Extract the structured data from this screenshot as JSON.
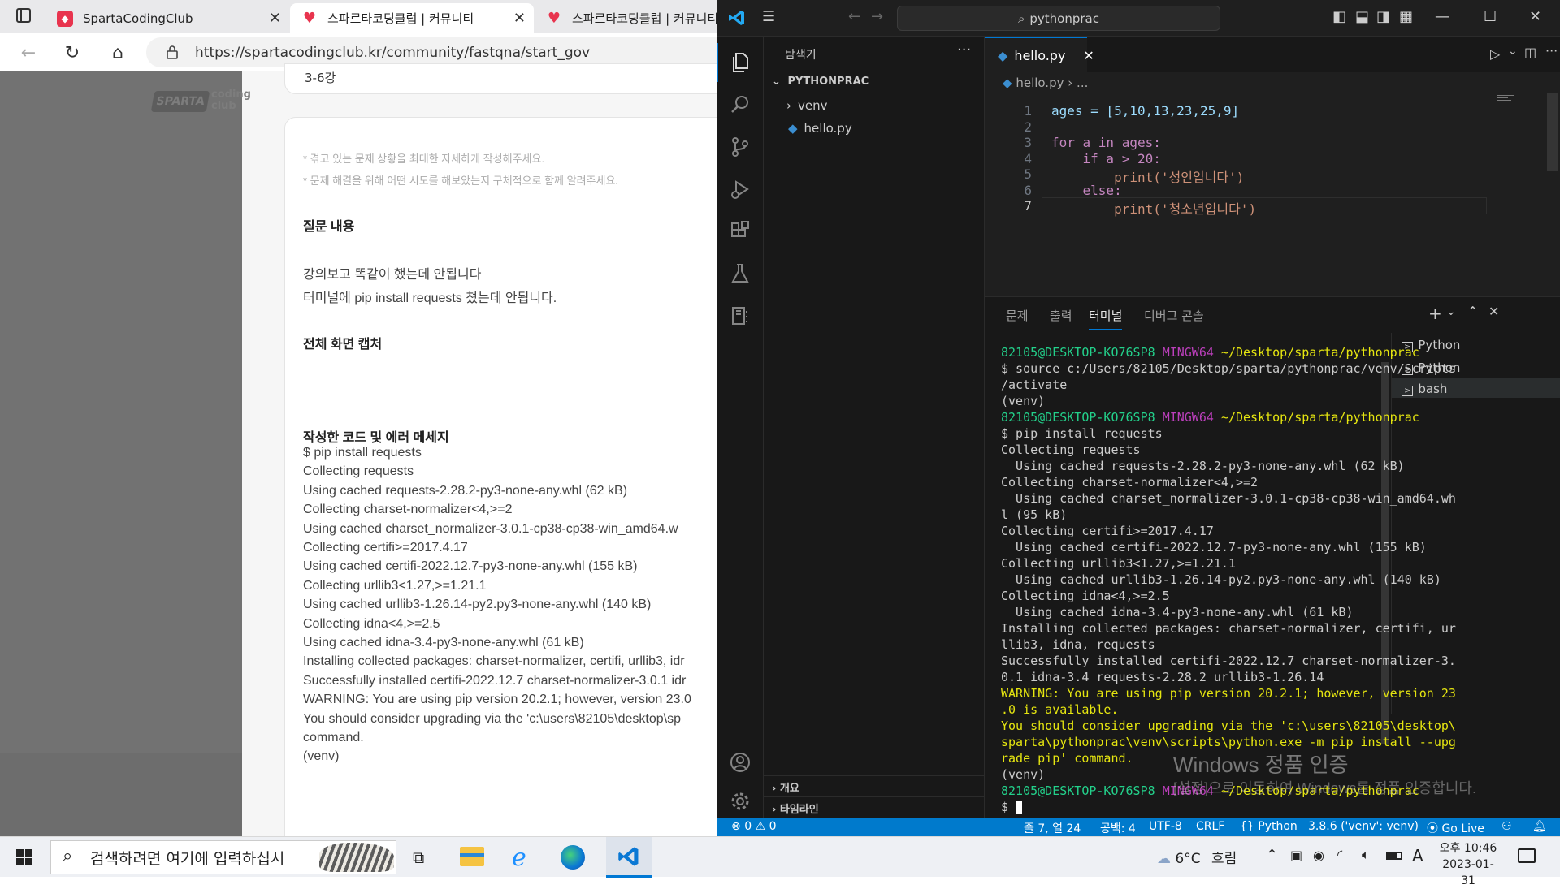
{
  "browser": {
    "tabs": [
      {
        "title": "SpartaCodingClub",
        "active": false
      },
      {
        "title": "스파르타코딩클럽 | 커뮤니티",
        "active": true
      },
      {
        "title": "스파르타코딩클럽 | 커뮤니티",
        "active": false
      }
    ],
    "url": "https://spartacodingclub.kr/community/fastqna/start_gov",
    "logo_text": "SPARTA",
    "logo_sub": "coding club",
    "prev_card_text": "3-6강",
    "notes": [
      "* 겪고 있는 문제 상황을 최대한 자세하게 작성해주세요.",
      "* 문제 해결을 위해 어떤 시도를 해보았는지 구체적으로 함께 알려주세요."
    ],
    "section_question": "질문 내용",
    "question_lines": [
      "강의보고 똑같이 했는데 안됩니다",
      "터미널에 pip install requests 쳤는데 안됩니다."
    ],
    "section_capture": "전체 화면 캡처",
    "section_code": "작성한 코드 및 에러 메세지",
    "code_lines": [
      "$ pip install requests",
      "Collecting requests",
      " Using cached requests-2.28.2-py3-none-any.whl (62 kB)",
      "Collecting charset-normalizer<4,>=2",
      " Using cached charset_normalizer-3.0.1-cp38-cp38-win_amd64.w",
      "Collecting certifi>=2017.4.17",
      " Using cached certifi-2022.12.7-py3-none-any.whl (155 kB)",
      "Collecting urllib3<1.27,>=1.21.1",
      " Using cached urllib3-1.26.14-py2.py3-none-any.whl (140 kB)",
      "Collecting idna<4,>=2.5",
      " Using cached idna-3.4-py3-none-any.whl (61 kB)",
      "Installing collected packages: charset-normalizer, certifi, urllib3, idr",
      "Successfully installed certifi-2022.12.7 charset-normalizer-3.0.1 idr",
      "WARNING: You are using pip version 20.2.1; however, version 23.0",
      "You should consider upgrading via the 'c:\\users\\82105\\desktop\\sp",
      "command.",
      "(venv)"
    ]
  },
  "vscode": {
    "search": "pythonprac",
    "explorer_title": "탐색기",
    "folder": "PYTHONPRAC",
    "tree": [
      "venv",
      "hello.py"
    ],
    "outline": "개요",
    "timeline": "타임라인",
    "tab": "hello.py",
    "breadcrumb_file": "hello.py",
    "breadcrumb_rest": "...",
    "code": [
      "ages = [5,10,13,23,25,9]",
      "",
      "for a in ages:",
      "    if a > 20:",
      "        print('성인입니다')",
      "    else:",
      "        print('청소년입니다')"
    ],
    "panel_tabs": [
      "문제",
      "출력",
      "터미널",
      "디버그 콘솔"
    ],
    "terminal_list": [
      "Python",
      "Python",
      "bash"
    ],
    "terminal": [
      "82105@DESKTOP-KO76SP8 MINGW64 ~/Desktop/sparta/pythonprac",
      "$ source c:/Users/82105/Desktop/sparta/pythonprac/venv/Scripts",
      "/activate",
      "(venv)",
      "82105@DESKTOP-KO76SP8 MINGW64 ~/Desktop/sparta/pythonprac",
      "$ pip install requests",
      "Collecting requests",
      "  Using cached requests-2.28.2-py3-none-any.whl (62 kB)",
      "Collecting charset-normalizer<4,>=2",
      "  Using cached charset_normalizer-3.0.1-cp38-cp38-win_amd64.wh",
      "l (95 kB)",
      "Collecting certifi>=2017.4.17",
      "  Using cached certifi-2022.12.7-py3-none-any.whl (155 kB)",
      "Collecting urllib3<1.27,>=1.21.1",
      "  Using cached urllib3-1.26.14-py2.py3-none-any.whl (140 kB)",
      "Collecting idna<4,>=2.5",
      "  Using cached idna-3.4-py3-none-any.whl (61 kB)",
      "Installing collected packages: charset-normalizer, certifi, ur",
      "llib3, idna, requests",
      "Successfully installed certifi-2022.12.7 charset-normalizer-3.",
      "0.1 idna-3.4 requests-2.28.2 urllib3-1.26.14",
      "WARNING: You are using pip version 20.2.1; however, version 23",
      ".0 is available.",
      "You should consider upgrading via the 'c:\\users\\82105\\desktop\\",
      "sparta\\pythonprac\\venv\\scripts\\python.exe -m pip install --upg",
      "rade pip' command.",
      "(venv)",
      "82105@DESKTOP-KO76SP8 MINGW64 ~/Desktop/sparta/pythonprac",
      "$ "
    ],
    "status": {
      "errors": "0",
      "warnings": "0",
      "position": "줄 7, 열 24",
      "spaces": "공백: 4",
      "encoding": "UTF-8",
      "eol": "CRLF",
      "language": "Python",
      "interpreter": "3.8.6 ('venv': venv)",
      "golive": "Go Live"
    },
    "watermark_title": "Windows 정품 인증",
    "watermark_sub": "[설정]으로 이동하여 Windows를 정품 인증합니다."
  },
  "taskbar": {
    "search_placeholder": "검색하려면 여기에 입력하십시",
    "weather_temp": "6°C",
    "weather_desc": "흐림",
    "ime": "A",
    "time": "오후 10:46",
    "date": "2023-01-31"
  },
  "colors": {
    "vscode_accent": "#007acc",
    "term_green": "#23d18b",
    "term_purple": "#bc3fbc",
    "term_yellow": "#e5e510"
  }
}
